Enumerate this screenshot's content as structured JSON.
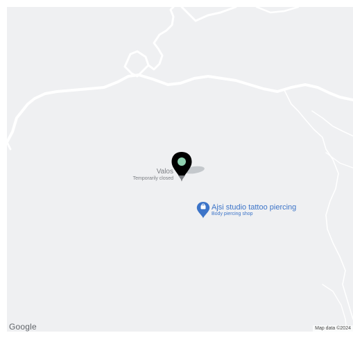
{
  "map": {
    "marker_place": {
      "name": "Valos",
      "status": "Temporarily closed"
    },
    "poi": {
      "name": "Ajsi studio tattoo piercing",
      "category": "Body piercing shop",
      "icon": "shopping-bag-icon"
    },
    "attribution": {
      "logo": "Google",
      "data": "Map data ©2024"
    },
    "colors": {
      "land": "#eff0f2",
      "road": "#ffffff",
      "poi": "#3c74c8",
      "marker": "#000000",
      "marker_dot": "#8fd0b0"
    }
  }
}
